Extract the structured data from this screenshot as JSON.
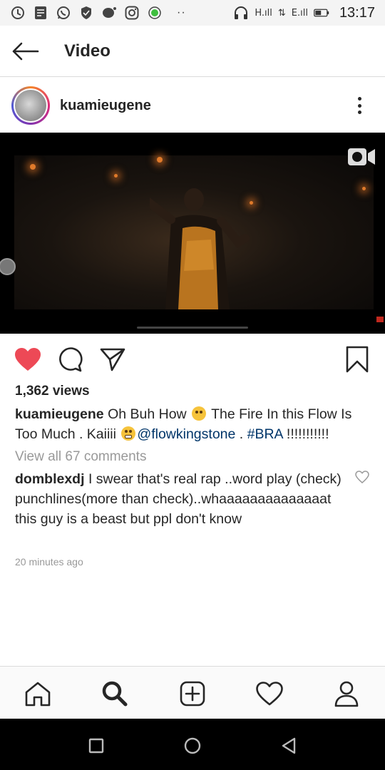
{
  "status_bar": {
    "time": "13:17",
    "signal_1": "H.ıll",
    "data_arrows": "⇅",
    "signal_2": "E.ıll",
    "icons": [
      "data-saver-icon",
      "notes-icon",
      "whatsapp-icon",
      "shield-icon",
      "chat-icon",
      "instagram-icon",
      "circle-app-icon",
      "headphones-icon",
      "battery-icon"
    ],
    "dots": "··"
  },
  "header": {
    "title": "Video"
  },
  "post": {
    "username": "kuamieugene",
    "views": "1,362 views",
    "caption_user": "kuamieugene",
    "caption_part1": "Oh Buh How",
    "caption_part2": "The Fire In this Flow Is Too Much . Kaiiii",
    "mention": "@flowkingstone",
    "caption_sep": " . ",
    "hashtag": "#BRA",
    "caption_end": " !!!!!!!!!!!",
    "view_all_comments": "View all 67 comments",
    "comment_user": "domblexdj",
    "comment_text": "I swear that's real rap ..word play (check) punchlines(more than check)..whaaaaaaaaaaaaaat this guy is a beast but ppl don't know",
    "time_ago": "20 minutes ago",
    "liked": true
  },
  "colors": {
    "like_red": "#ed4956",
    "link_blue": "#003569",
    "muted_gray": "#999999"
  }
}
